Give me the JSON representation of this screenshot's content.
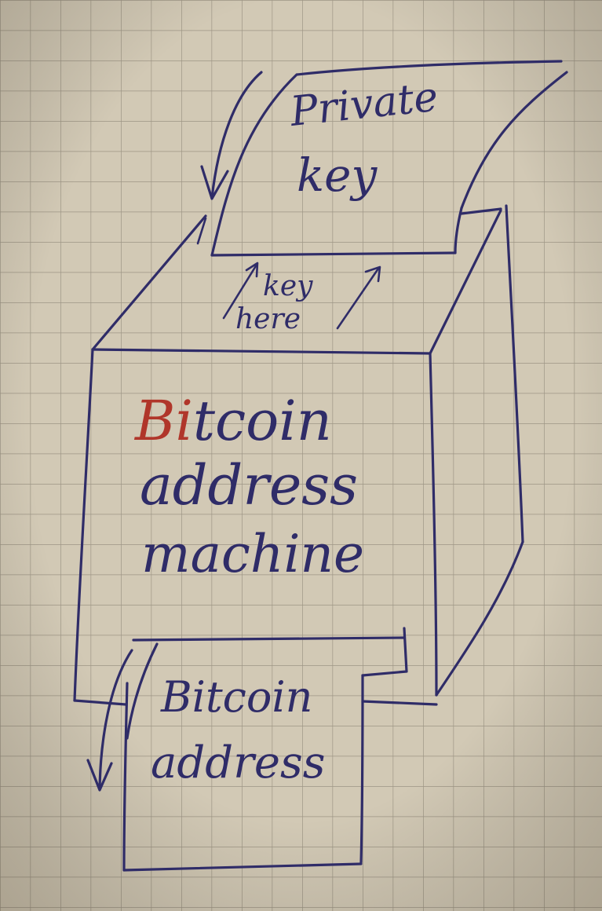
{
  "paper": {
    "background": "#cfc6b2",
    "grid_color": "#9d9585",
    "ink_color": "#2f2c68",
    "accent_color": "#b0362a"
  },
  "top_sheet": {
    "line1": "Private",
    "line2": "key"
  },
  "slot_label": {
    "line1": "key",
    "line2": "here"
  },
  "machine": {
    "word1_accent": "Bi",
    "word1_rest": "tcoin",
    "line2": "address",
    "line3": "machine"
  },
  "bottom_sheet": {
    "line1": "Bitcoin",
    "line2": "address"
  }
}
